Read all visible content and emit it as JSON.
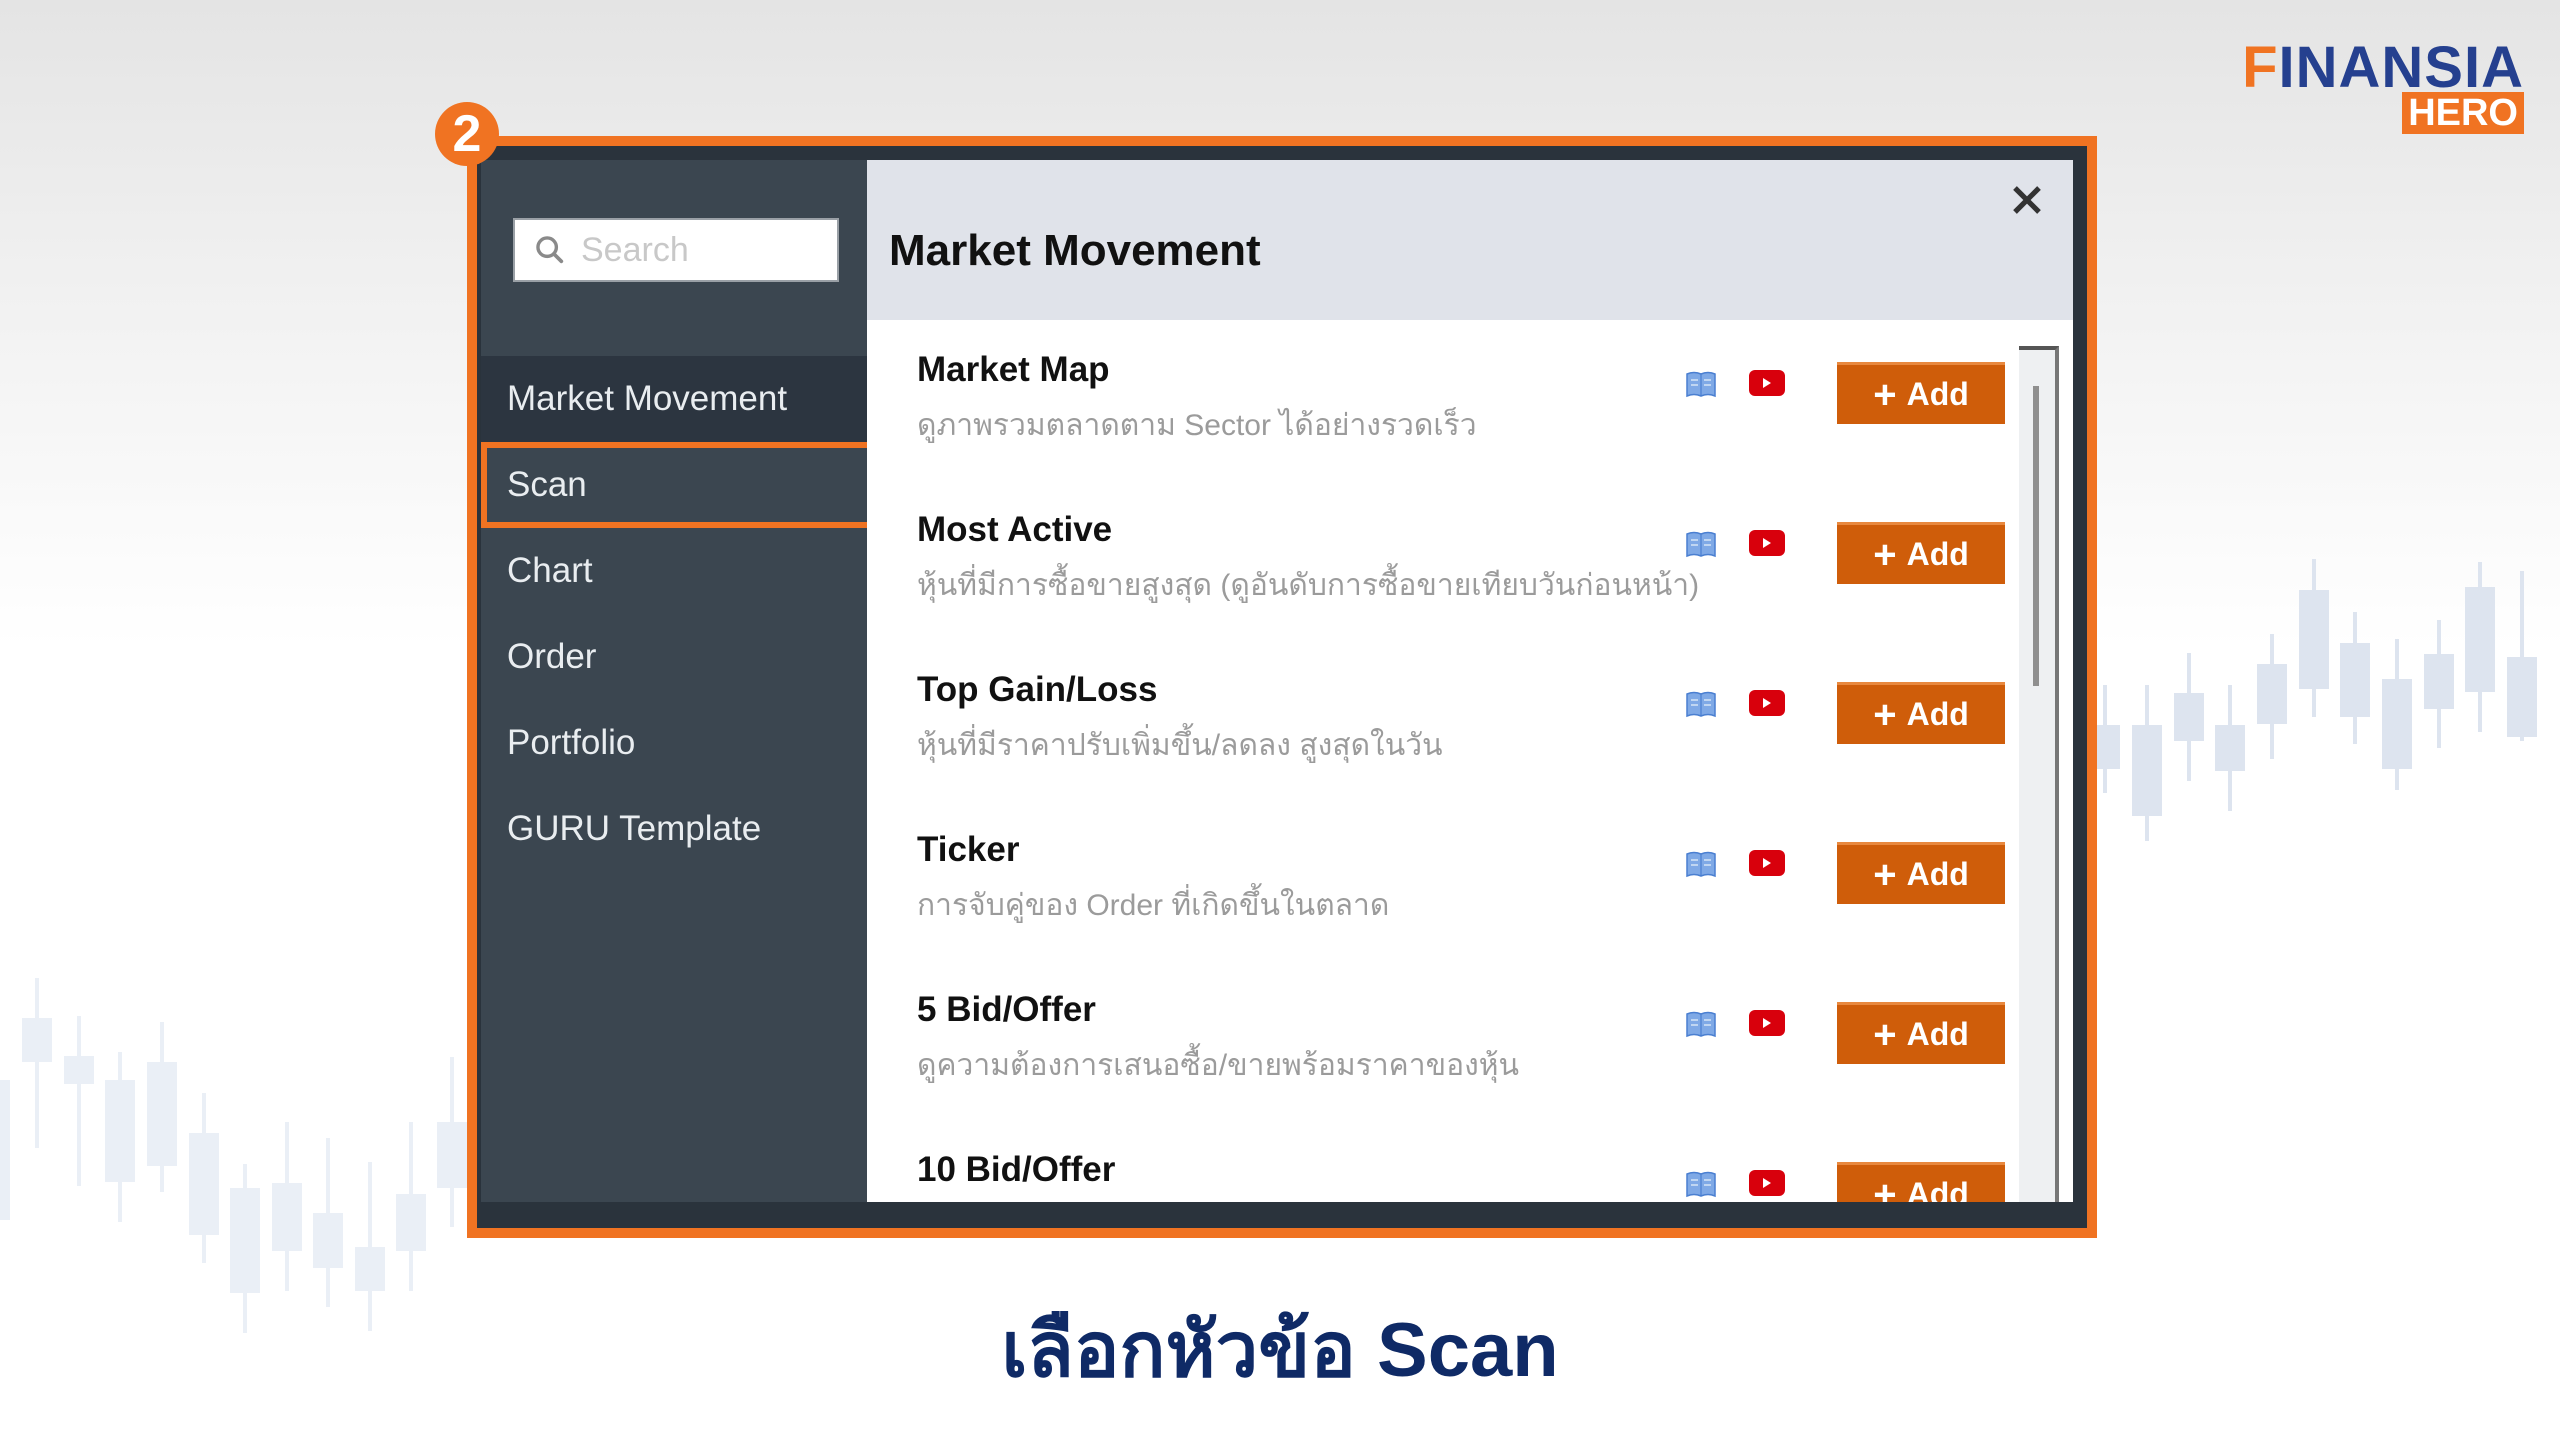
{
  "brand": {
    "logo_main_prefix": "F",
    "logo_main_rest": "INANSIA",
    "logo_sub": "HERO",
    "primary_color": "#25408f",
    "accent_color": "#f07322"
  },
  "step": {
    "number": "2"
  },
  "sidebar": {
    "search": {
      "placeholder": "Search",
      "value": "",
      "icon": "search-icon"
    },
    "items": [
      {
        "label": "Market Movement",
        "active": true
      },
      {
        "label": "Scan",
        "highlighted": true
      },
      {
        "label": "Chart"
      },
      {
        "label": "Order"
      },
      {
        "label": "Portfolio"
      },
      {
        "label": "GURU Template"
      }
    ]
  },
  "main": {
    "title": "Market Movement",
    "close_icon": "close-icon",
    "items": [
      {
        "name": "Market Map",
        "desc": "ดูภาพรวมตลาดตาม Sector ได้อย่างรวดเร็ว",
        "add_label": "Add"
      },
      {
        "name": "Most Active",
        "desc": "หุ้นที่มีการซื้อขายสูงสุด (ดูอันดับการซื้อขายเทียบวันก่อนหน้า)",
        "add_label": "Add"
      },
      {
        "name": "Top Gain/Loss",
        "desc": "หุ้นที่มีราคาปรับเพิ่มขึ้น/ลดลง สูงสุดในวัน",
        "add_label": "Add"
      },
      {
        "name": "Ticker",
        "desc": "การจับคู่ของ Order ที่เกิดขึ้นในตลาด",
        "add_label": "Add"
      },
      {
        "name": "5 Bid/Offer",
        "desc": "ดูความต้องการเสนอซื้อ/ขายพร้อมราคาของหุ้น",
        "add_label": "Add"
      },
      {
        "name": "10 Bid/Offer",
        "desc": "",
        "add_label": "Add"
      }
    ],
    "icons": {
      "manual": "book-icon",
      "video": "youtube-icon"
    }
  },
  "caption": "เลือกหัวข้อ Scan"
}
